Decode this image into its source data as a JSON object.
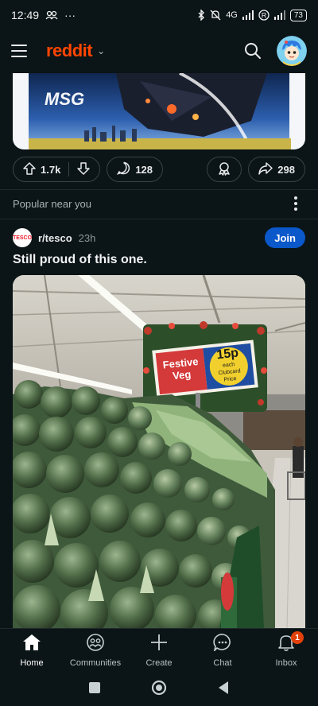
{
  "status_bar": {
    "time": "12:49",
    "ellipsis": "···",
    "network": "4G",
    "battery": "73"
  },
  "header": {
    "logo": "reddit"
  },
  "top_post": {
    "image_text": "MSG",
    "upvotes": "1.7k",
    "comments": "128",
    "shares": "298"
  },
  "section": {
    "label": "Popular near you"
  },
  "post": {
    "subreddit": "r/tesco",
    "subreddit_icon_text": "TESCO",
    "age": "23h",
    "join_label": "Join",
    "title": "Still proud of this one.",
    "sign": {
      "line1": "Festive",
      "line2": "Veg",
      "price": "15p",
      "each": "each",
      "clubcard1": "Clubcard",
      "clubcard2": "Price"
    }
  },
  "bottom_nav": [
    {
      "label": "Home",
      "icon": "home-icon",
      "active": true
    },
    {
      "label": "Communities",
      "icon": "communities-icon"
    },
    {
      "label": "Create",
      "icon": "plus-icon"
    },
    {
      "label": "Chat",
      "icon": "chat-icon"
    },
    {
      "label": "Inbox",
      "icon": "bell-icon",
      "badge": "1"
    }
  ],
  "colors": {
    "background": "#0b1416",
    "brand": "#ff4500",
    "join": "#0a58ca",
    "badge": "#e3410a"
  }
}
